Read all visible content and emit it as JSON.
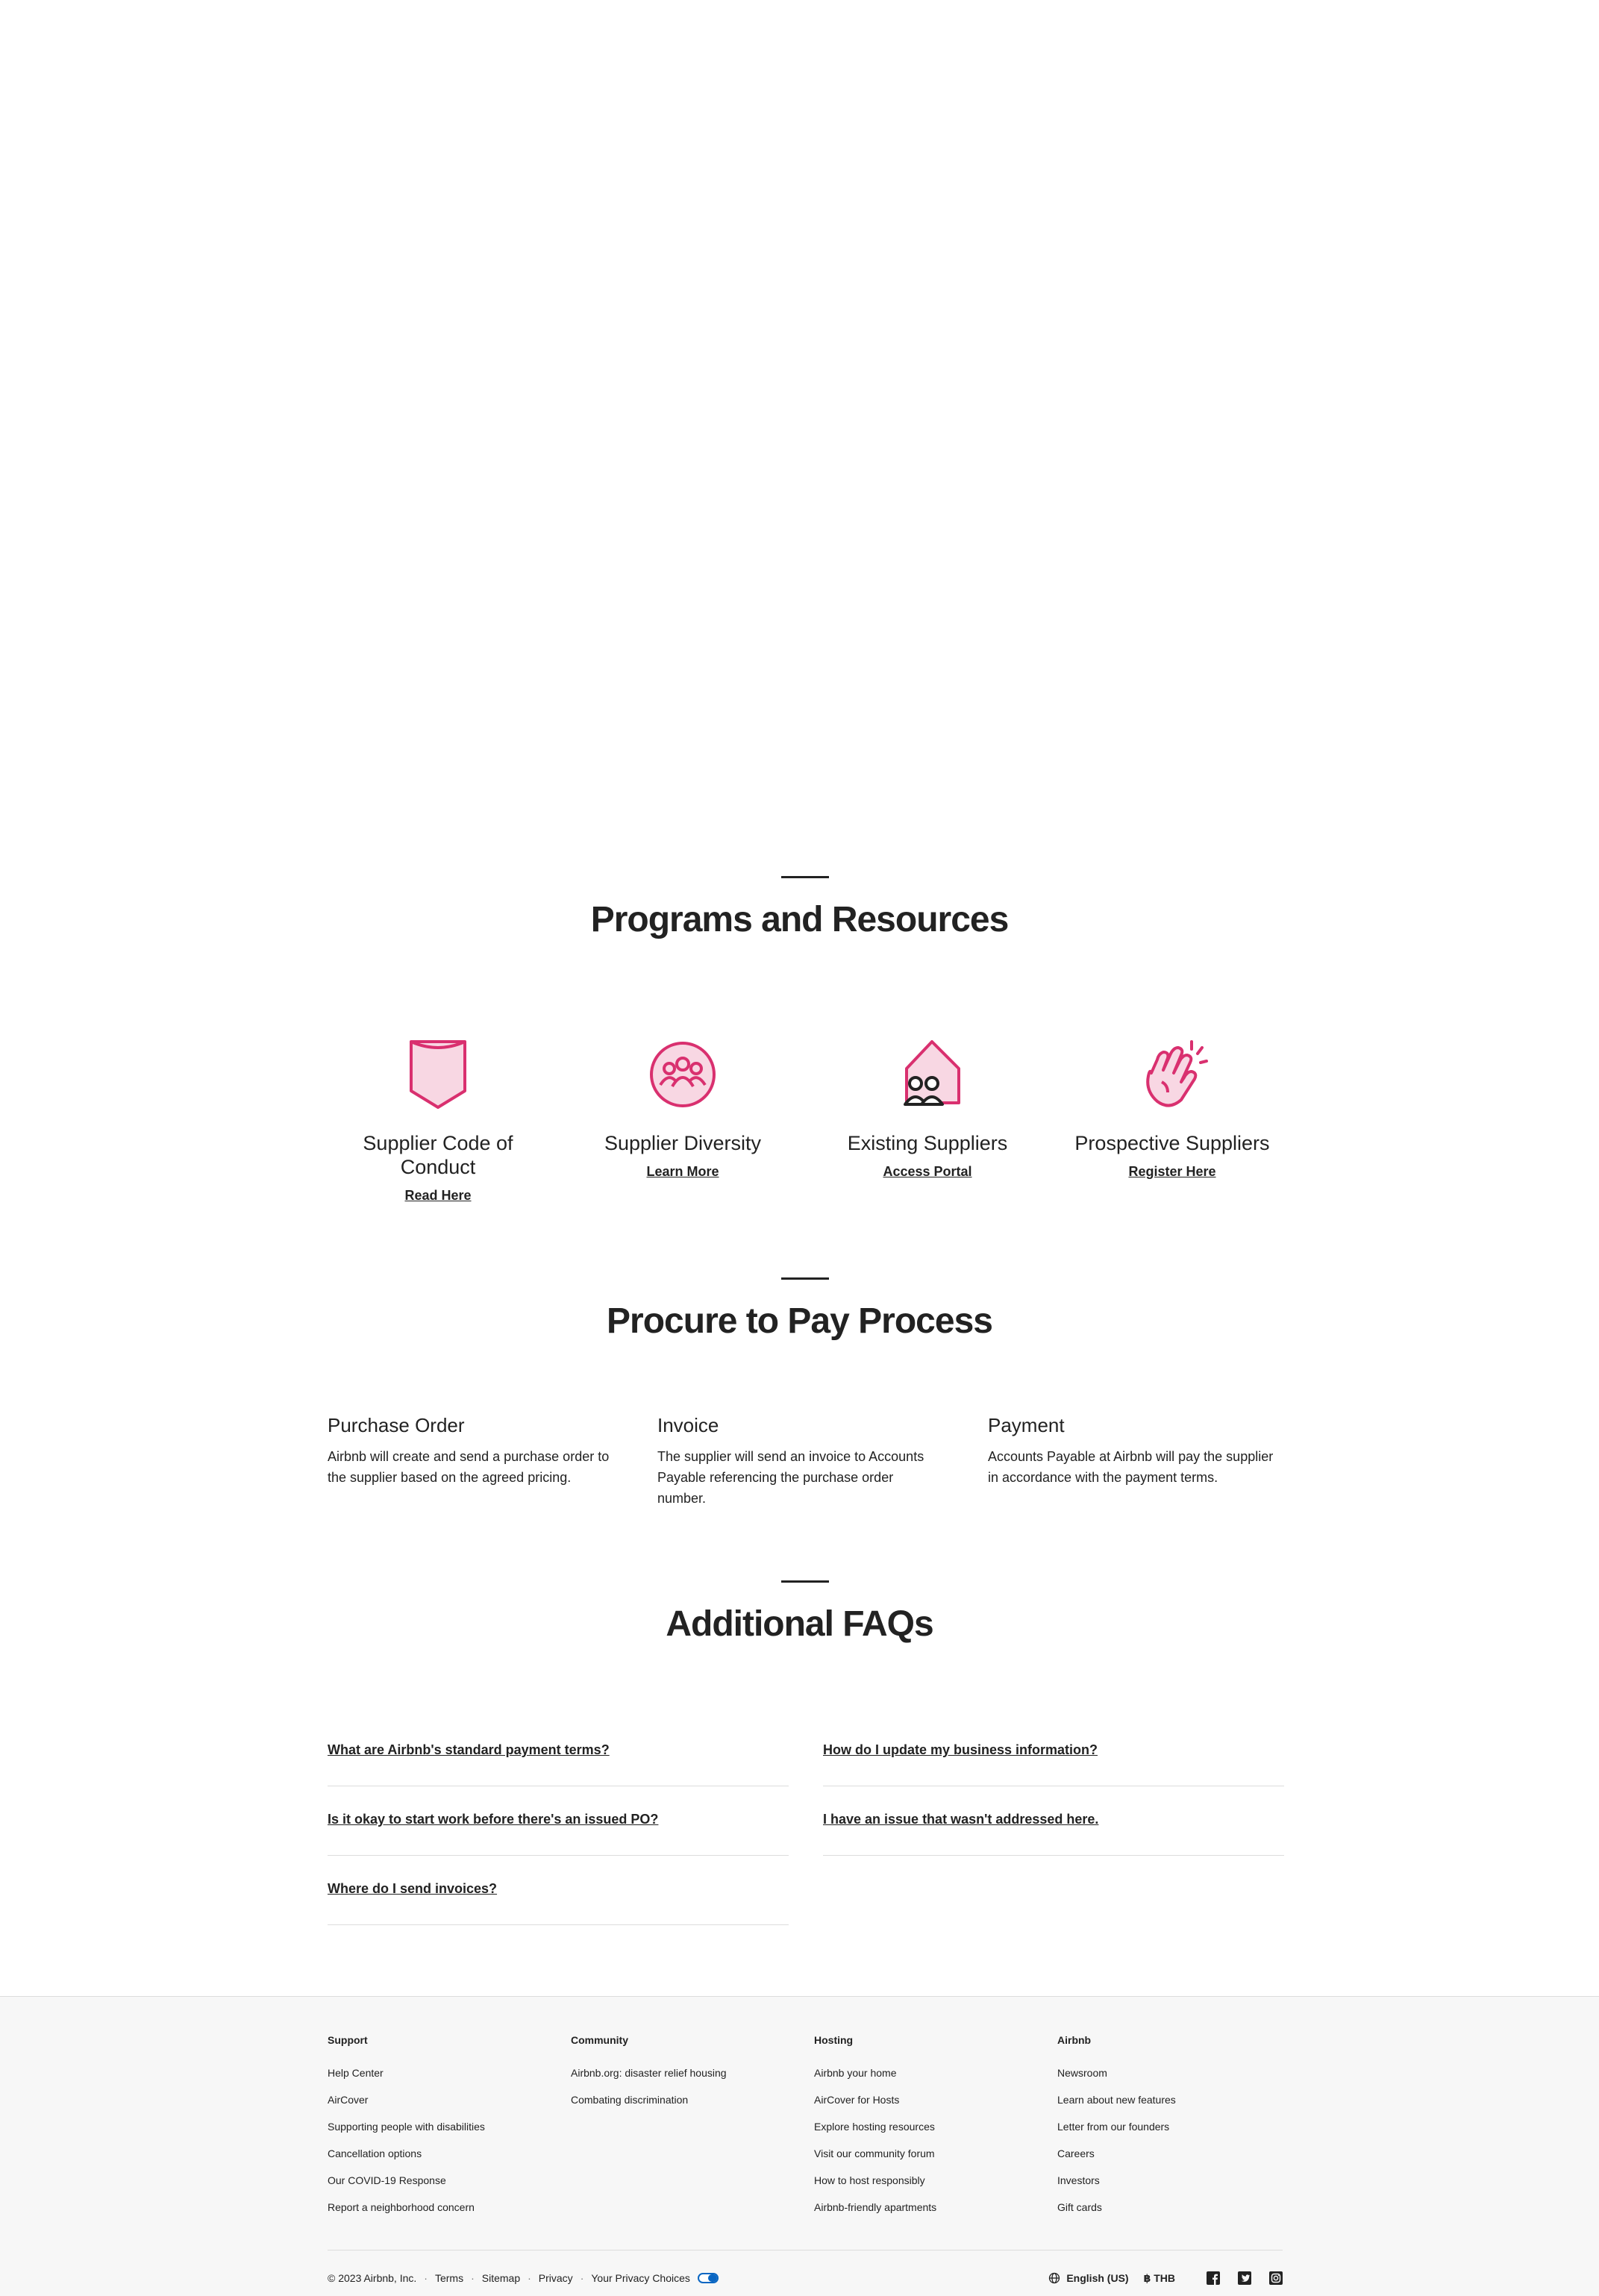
{
  "programs_section": {
    "title": "Programs and Resources",
    "items": [
      {
        "title": "Supplier Code of Conduct",
        "link": "Read Here",
        "icon": "shield-icon"
      },
      {
        "title": "Supplier Diversity",
        "link": "Learn More",
        "icon": "people-circle-icon"
      },
      {
        "title": "Existing Suppliers",
        "link": "Access Portal",
        "icon": "house-people-icon"
      },
      {
        "title": "Prospective Suppliers",
        "link": "Register Here",
        "icon": "waving-hand-icon"
      }
    ]
  },
  "process_section": {
    "title": "Procure to Pay Process",
    "steps": [
      {
        "title": "Purchase Order",
        "text": "Airbnb will create and send a purchase order to the supplier based on the agreed pricing."
      },
      {
        "title": "Invoice",
        "text": "The supplier will send an invoice to Accounts Payable referencing the purchase order number."
      },
      {
        "title": "Payment",
        "text": "Accounts Payable at Airbnb will pay the supplier in accordance with the payment terms."
      }
    ]
  },
  "faq_section": {
    "title": "Additional FAQs",
    "left": [
      "What are Airbnb's standard payment terms?",
      "Is it okay to start work before there's an issued PO?",
      "Where do I send invoices?"
    ],
    "right": [
      "How do I update my business information?",
      "I have an issue that wasn't addressed here."
    ]
  },
  "footer": {
    "columns": [
      {
        "heading": "Support",
        "links": [
          "Help Center",
          "AirCover",
          "Supporting people with disabilities",
          "Cancellation options",
          "Our COVID-19 Response",
          "Report a neighborhood concern"
        ]
      },
      {
        "heading": "Community",
        "links": [
          "Airbnb.org: disaster relief housing",
          "Combating discrimination"
        ]
      },
      {
        "heading": "Hosting",
        "links": [
          "Airbnb your home",
          "AirCover for Hosts",
          "Explore hosting resources",
          "Visit our community forum",
          "How to host responsibly",
          "Airbnb-friendly apartments"
        ]
      },
      {
        "heading": "Airbnb",
        "links": [
          "Newsroom",
          "Learn about new features",
          "Letter from our founders",
          "Careers",
          "Investors",
          "Gift cards"
        ]
      }
    ],
    "copyright": "© 2023 Airbnb, Inc.",
    "legal_links": [
      "Terms",
      "Sitemap",
      "Privacy",
      "Your Privacy Choices"
    ],
    "separator": "·",
    "language": "English (US)",
    "currency_symbol": "฿",
    "currency": "THB",
    "social": [
      "facebook-icon",
      "twitter-icon",
      "instagram-icon"
    ]
  },
  "colors": {
    "accent": "#d9306f",
    "accent_fill": "#f8d7e3",
    "text": "#222222",
    "footer_bg": "#f7f7f7",
    "privacy_blue": "#0a66c2"
  }
}
